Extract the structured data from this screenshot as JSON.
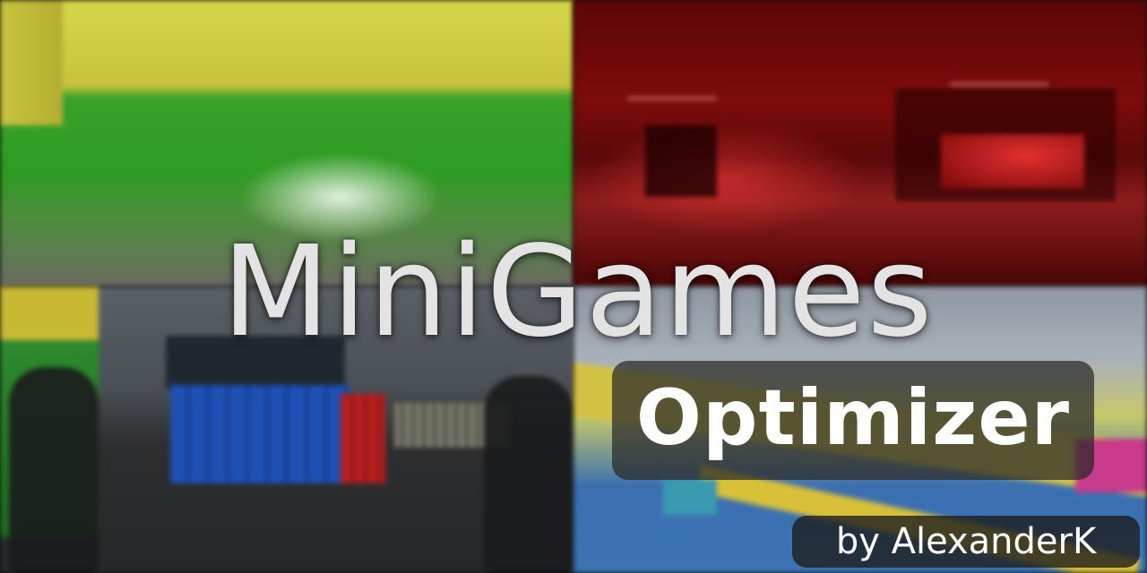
{
  "banner": {
    "title": "MiniGames",
    "subtitle": "Optimizer",
    "byline": "by AlexanderK"
  },
  "colors": {
    "title_text": "#e3e3e3",
    "subtitle_text": "#ffffff",
    "subtitle_box": "rgba(40,40,40,0.72)",
    "byline_box": "rgba(30,30,30,0.8)"
  },
  "scenes": [
    {
      "name": "green-arena",
      "palette": [
        "#d7d64a",
        "#2e9b22"
      ]
    },
    {
      "name": "red-room",
      "palette": [
        "#7d0b0b",
        "#e23030"
      ]
    },
    {
      "name": "container-yard",
      "palette": [
        "#1e4fb3",
        "#b51f1f"
      ]
    },
    {
      "name": "blocks-course",
      "palette": [
        "#d2c244",
        "#3c74b5"
      ]
    }
  ]
}
